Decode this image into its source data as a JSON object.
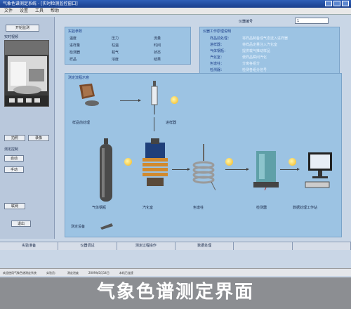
{
  "window": {
    "title": "气象色谱测定系统 - [实时检测监控窗口]",
    "menu": [
      "文件",
      "设置",
      "工具",
      "帮助"
    ]
  },
  "left_panel": {
    "start_button": "开始监测",
    "camera_label": "实时视频",
    "snap_buttons": [
      "拍照",
      "录像"
    ],
    "section_label": "测定控制",
    "ctrl_buttons": [
      "自动",
      "手动"
    ],
    "side_buttons": [
      "联网",
      "退出"
    ]
  },
  "top_field": {
    "label": "仪器编号",
    "value": "1"
  },
  "params_panel": {
    "title": "实验参数",
    "rows": [
      {
        "k1": "温度",
        "v1": "",
        "k2": "压力",
        "v2": "",
        "k3": "流量",
        "v3": ""
      },
      {
        "k1": "进样量",
        "v1": "",
        "k2": "柱温",
        "v2": "",
        "k3": "时间",
        "v3": ""
      },
      {
        "k1": "检测器",
        "v1": "",
        "k2": "载气",
        "v2": "",
        "k3": "状态",
        "v3": ""
      },
      {
        "k1": "样品",
        "v1": "",
        "k2": "浓度",
        "v2": "",
        "k3": "结果",
        "v3": ""
      }
    ]
  },
  "info_panel": {
    "title": "仪器工作原理说明",
    "lines": [
      {
        "key": "样品前处理：",
        "val": "将样品制备成气态送入进样器"
      },
      {
        "key": "进样器：",
        "val": "将样品定量注入汽化室"
      },
      {
        "key": "气体钢瓶：",
        "val": "提供载气推动样品"
      },
      {
        "key": "汽化室：",
        "val": "使样品瞬间汽化"
      },
      {
        "key": "色谱柱：",
        "val": "分离各组分"
      },
      {
        "key": "检测器：",
        "val": "检测各组分信号"
      }
    ]
  },
  "process_panel": {
    "title": "测定流程示意",
    "components": {
      "sample_prep": "样品前处理",
      "injector": "进样器",
      "gas_cylinder": "气体钢瓶",
      "vaporizer": "汽化室",
      "column": "色谱柱",
      "detector": "检测器",
      "computer": "数据处理工作站"
    },
    "footer_label": "测定设备"
  },
  "bottom_tabs": [
    "实验准备",
    "仪器调试",
    "测定过程操作",
    "数据处理",
    "",
    ""
  ],
  "status_bar": [
    "欢迎使用气象色谱测定系统",
    "实验员：",
    "测定进度",
    "2009年5月14日",
    "本机已连接"
  ],
  "caption": "气象色谱测定界面"
}
